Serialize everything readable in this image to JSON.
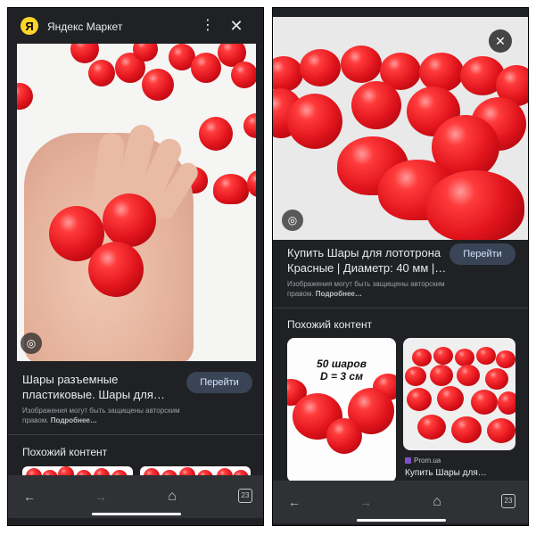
{
  "left": {
    "site_logo_letter": "Я",
    "site_name": "Яндекс Маркет",
    "caption_line1": "Шары разъемные",
    "caption_line2": "пластиковые. Шары для…",
    "goto_label": "Перейти",
    "copyright_line1": "Изображения могут быть защищены авторским",
    "copyright_prefix": "правом.",
    "copyright_more": "Подробнее…",
    "similar_title": "Похожий контент",
    "tabs_count": "23"
  },
  "right": {
    "caption_line1": "Купить Шары для лототрона",
    "caption_line2": "Красные | Диаметр: 40 мм |…",
    "goto_label": "Перейти",
    "copyright_line1": "Изображения могут быть защищены авторским",
    "copyright_prefix": "правом.",
    "copyright_more": "Подробнее…",
    "similar_title": "Похожий контент",
    "card1_overlay_line1": "50 шаров",
    "card1_overlay_line2": "D = 3 см",
    "card2_source": "Prom.ua",
    "card2_title": "Купить Шары для…",
    "tabs_count": "23"
  },
  "icons": {
    "more": "⋮",
    "close": "✕",
    "lens": "◎",
    "back": "←",
    "forward": "→",
    "home": "⌂"
  },
  "colors": {
    "background_dark": "#202124",
    "button_bg": "#394457",
    "button_text": "#d2e3fc",
    "ball_red": "#e0141c",
    "brand_yellow": "#fed42b"
  }
}
